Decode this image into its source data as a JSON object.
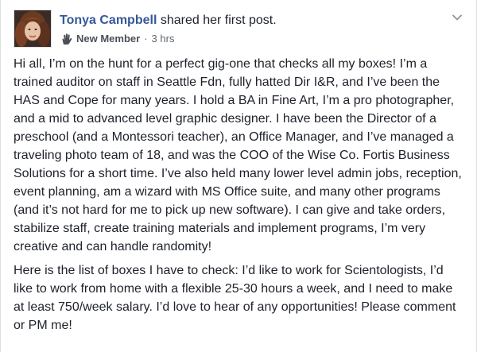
{
  "post": {
    "author": "Tonya Campbell",
    "action": "shared her first post.",
    "badge": {
      "icon": "wave-hand-icon",
      "label": "New Member"
    },
    "separator": "·",
    "timestamp": "3 hrs",
    "menu_icon": "chevron-down-icon",
    "paragraphs": [
      "Hi all, I’m on the hunt for a perfect gig-one that checks all my boxes! I’m a trained auditor on staff in Seattle Fdn, fully hatted Dir I&R, and I’ve been the HAS and Cope for many years. I hold a BA in Fine Art, I’m a pro photographer, and a mid to advanced level graphic designer. I have been the Director of a preschool (and a Montessori teacher), an Office Manager, and I’ve managed a traveling photo team of 18, and was the COO of the Wise Co. Fortis Business Solutions for a short time. I’ve also held many lower level admin jobs, reception, event planning, am a wizard with MS Office suite, and many other programs (and it’s not hard for me to pick up new software). I can give and take orders, stabilize staff, create training materials and implement programs, I’m very creative and can handle randomity!",
      "Here is the list of boxes I have to check: I’d like to work for Scientologists, I’d like to work from home with a flexible 25-30 hours a week, and I need to make at least 750/week salary. I’d love to hear of any opportunities! Please comment or PM me!"
    ]
  },
  "colors": {
    "author_link": "#365899",
    "body_text": "#1d2129",
    "meta_text": "#616770",
    "badge_label": "#4b4f56"
  }
}
